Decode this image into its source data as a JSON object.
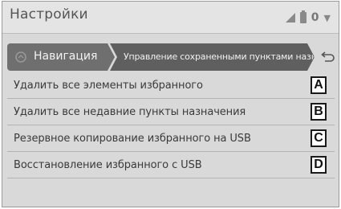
{
  "header": {
    "title": "Настройки",
    "status_zero": "0"
  },
  "breadcrumb": {
    "nav_label": "Навигация",
    "current_label": "Управление сохраненными пунктами назна."
  },
  "items": [
    {
      "label": "Удалить все элементы избранного",
      "badge": "A"
    },
    {
      "label": "Удалить все недавние пункты назначения",
      "badge": "B"
    },
    {
      "label": "Резервное копирование избранного на USB",
      "badge": "C"
    },
    {
      "label": "Восстановление избранного с USB",
      "badge": "D"
    }
  ]
}
